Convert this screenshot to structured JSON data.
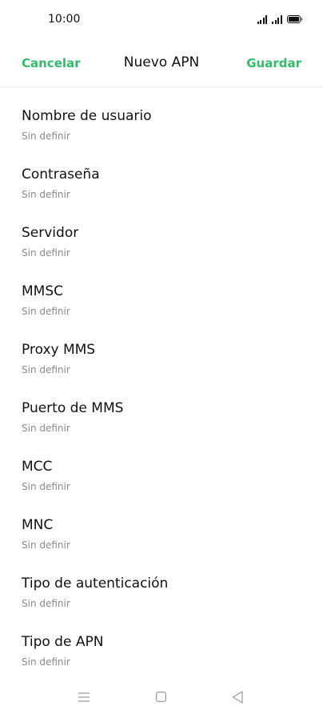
{
  "status_bar": {
    "time": "10:00"
  },
  "header": {
    "cancel_label": "Cancelar",
    "title": "Nuevo APN",
    "save_label": "Guardar"
  },
  "fields": [
    {
      "label": "Nombre de usuario",
      "value": "Sin definir"
    },
    {
      "label": "Contraseña",
      "value": "Sin definir"
    },
    {
      "label": "Servidor",
      "value": "Sin definir"
    },
    {
      "label": "MMSC",
      "value": "Sin definir"
    },
    {
      "label": "Proxy MMS",
      "value": "Sin definir"
    },
    {
      "label": "Puerto de MMS",
      "value": "Sin definir"
    },
    {
      "label": "MCC",
      "value": "Sin definir"
    },
    {
      "label": "MNC",
      "value": "Sin definir"
    },
    {
      "label": "Tipo de autenticación",
      "value": "Sin definir"
    },
    {
      "label": "Tipo de APN",
      "value": "Sin definir"
    }
  ],
  "nav_bar": {
    "icons": [
      "menu-icon",
      "home-icon",
      "back-icon"
    ]
  },
  "colors": {
    "accent": "#2fbd6b",
    "text_primary": "#111111",
    "text_secondary": "#8a8a8a",
    "divider": "#e9e9e9",
    "nav_icon": "#9a9a9a"
  }
}
